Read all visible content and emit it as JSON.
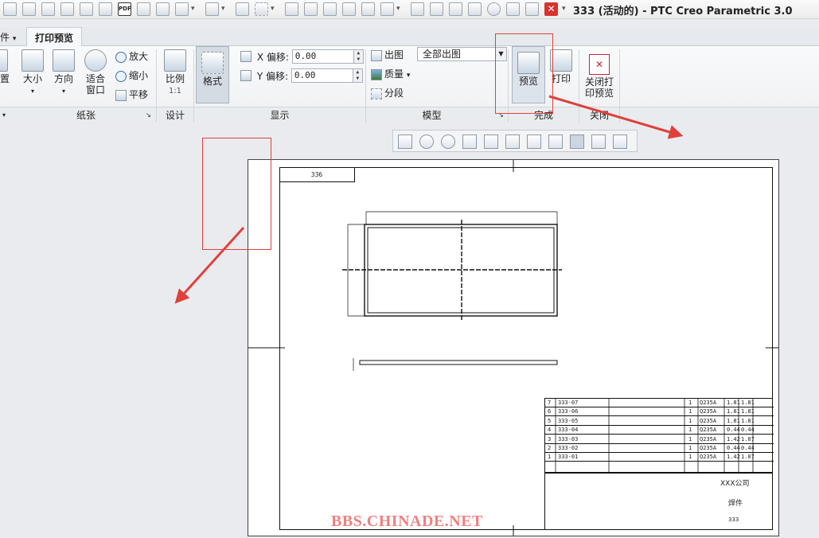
{
  "window": {
    "title": "333 (活动的) - PTC Creo Parametric 3.0"
  },
  "quick_access": {
    "icons": [
      "new-icon",
      "open-icon",
      "folder-open-icon",
      "save-icon",
      "save-copy-icon",
      "export-icon",
      "pdf-icon",
      "save-as-icon",
      "regenerate-icon",
      "undo-icon",
      "redo-icon",
      "render-icon",
      "select-box-icon",
      "plot-icon",
      "print-icon",
      "text-icon",
      "eraser-icon",
      "table-icon",
      "window-icon",
      "pen-icon",
      "printer-icon",
      "settings-icon",
      "doc-icon",
      "measure-icon",
      "close-window-icon"
    ],
    "pdf_label": "PDF"
  },
  "tabs": {
    "file_partial": "件",
    "active": "打印预览"
  },
  "ribbon": {
    "paper": {
      "label_partial": "置",
      "size": "大小",
      "orientation": "方向",
      "fit_line1": "适合",
      "fit_line2": "窗口",
      "zoom_in": "放大",
      "zoom_out": "缩小",
      "pan": "平移",
      "group": "纸张"
    },
    "design": {
      "scale": "比例",
      "scale_value": "1:1",
      "group": "设计"
    },
    "display": {
      "format": "格式",
      "x_offset_label": "X 偏移:",
      "x_offset_value": "0.00",
      "y_offset_label": "Y 偏移:",
      "y_offset_value": "0.00",
      "group": "显示"
    },
    "model": {
      "plot": "出图",
      "plot_option": "全部出图",
      "quality": "质量",
      "segment": "分段",
      "group": "模型"
    },
    "finish": {
      "preview": "预览",
      "print": "打印",
      "group": "完成"
    },
    "close": {
      "close_line1": "关闭打",
      "close_line2": "印预览",
      "group": "关闭"
    }
  },
  "drawing": {
    "sheet_label": "336",
    "bom_rows": [
      {
        "no": "7",
        "part": "333-07",
        "qty": "1",
        "material": "Q235A",
        "w1": "1.81",
        "w2": "1.81"
      },
      {
        "no": "6",
        "part": "333-06",
        "qty": "1",
        "material": "Q235A",
        "w1": "1.81",
        "w2": "1.81"
      },
      {
        "no": "5",
        "part": "333-05",
        "qty": "1",
        "material": "Q235A",
        "w1": "1.81",
        "w2": "1.81"
      },
      {
        "no": "4",
        "part": "333-04",
        "qty": "1",
        "material": "Q235A",
        "w1": "0.44",
        "w2": "0.44"
      },
      {
        "no": "3",
        "part": "333-03",
        "qty": "1",
        "material": "Q235A",
        "w1": "1.42",
        "w2": "1.07"
      },
      {
        "no": "2",
        "part": "333-02",
        "qty": "1",
        "material": "Q235A",
        "w1": "0.44",
        "w2": "0.44"
      },
      {
        "no": "1",
        "part": "333-01",
        "qty": "1",
        "material": "Q235A",
        "w1": "1.42",
        "w2": "1.07"
      }
    ],
    "company": "XXX公司",
    "drawing_name": "焊件",
    "drawing_number": "333"
  },
  "watermark": "BBS.CHINADE.NET",
  "colors": {
    "annotation_red": "#e0403a",
    "watermark": "#f08080"
  }
}
